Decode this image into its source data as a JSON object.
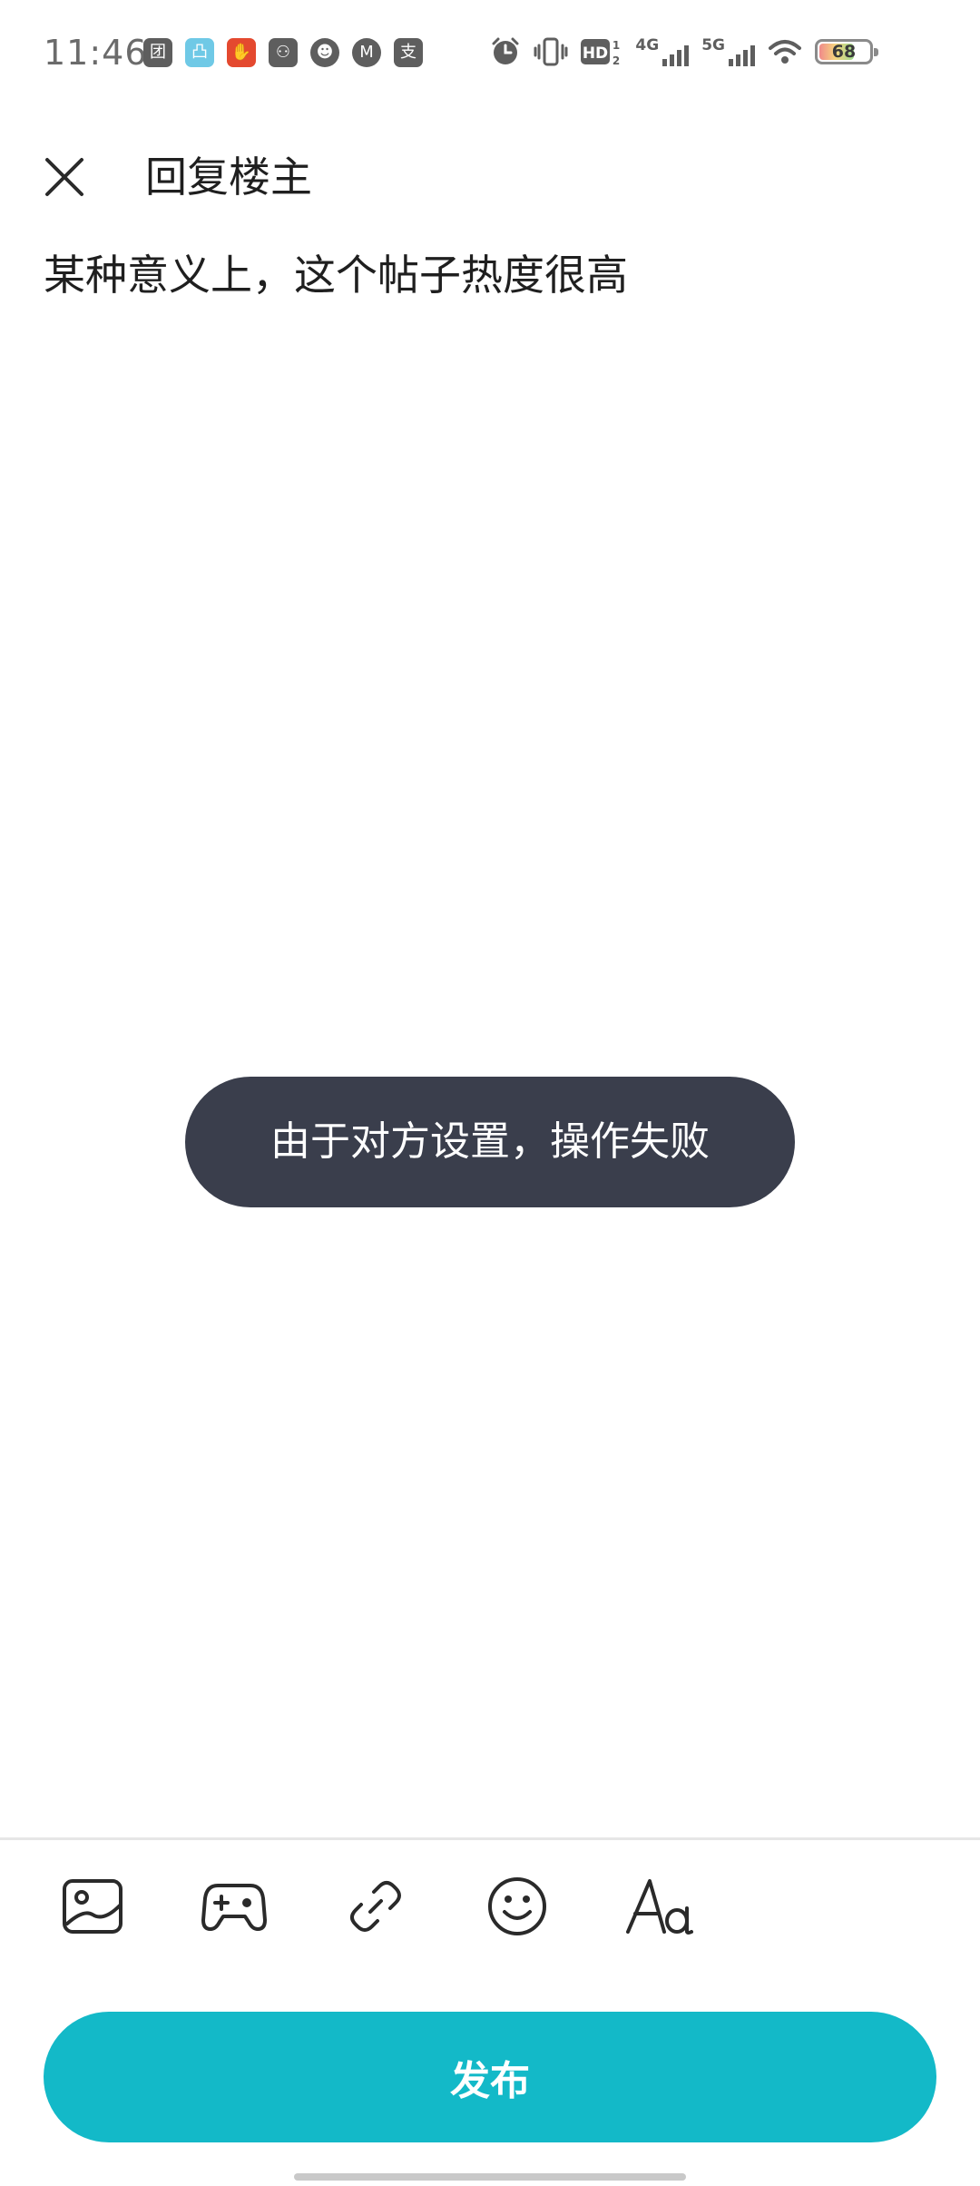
{
  "status_bar": {
    "time": "11:46",
    "left_icons": [
      {
        "name": "tuan-app-icon",
        "glyph": "团"
      },
      {
        "name": "cyan-app-icon",
        "glyph": "凸"
      },
      {
        "name": "red-app-icon",
        "glyph": "✋"
      },
      {
        "name": "game-app-icon",
        "glyph": "⚇"
      },
      {
        "name": "cat-app-icon",
        "glyph": "☻"
      },
      {
        "name": "mountain-app-icon",
        "glyph": "M"
      },
      {
        "name": "alipay-app-icon",
        "glyph": "支"
      }
    ],
    "network_1": "4G",
    "network_2": "5G",
    "battery_level": "68",
    "colors": {
      "text": "#6b6b6b",
      "icon": "#5e5e5e"
    }
  },
  "header": {
    "title": "回复楼主"
  },
  "editor": {
    "text": "某种意义上，这个帖子热度很高"
  },
  "toast": {
    "message": "由于对方设置，操作失败"
  },
  "toolbar": {
    "tools": [
      "image-icon",
      "gamepad-icon",
      "link-icon",
      "emoji-icon",
      "text-format-icon"
    ]
  },
  "publish": {
    "label": "发布",
    "color": "#13b9c8"
  }
}
